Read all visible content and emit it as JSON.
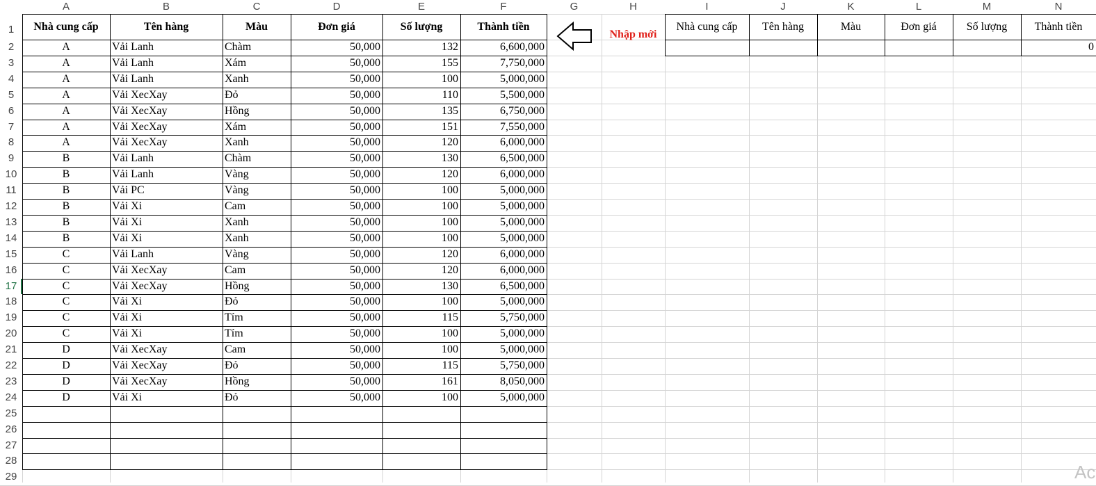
{
  "columns": [
    "A",
    "B",
    "C",
    "D",
    "E",
    "F",
    "G",
    "H",
    "I",
    "J",
    "K",
    "L",
    "M",
    "N"
  ],
  "rows": [
    "1",
    "2",
    "3",
    "4",
    "5",
    "6",
    "7",
    "8",
    "9",
    "10",
    "11",
    "12",
    "13",
    "14",
    "15",
    "16",
    "17",
    "18",
    "19",
    "20",
    "21",
    "22",
    "23",
    "24",
    "25",
    "26",
    "27",
    "28",
    "29"
  ],
  "active_row": "17",
  "table": {
    "headers": [
      "Nhà cung cấp",
      "Tên hàng",
      "Màu",
      "Đơn giá",
      "Số lượng",
      "Thành tiền"
    ],
    "rows": [
      [
        "A",
        "Vải Lanh",
        "Chàm",
        "50,000",
        "132",
        "6,600,000"
      ],
      [
        "A",
        "Vải Lanh",
        "Xám",
        "50,000",
        "155",
        "7,750,000"
      ],
      [
        "A",
        "Vải Lanh",
        "Xanh",
        "50,000",
        "100",
        "5,000,000"
      ],
      [
        "A",
        "Vải XecXay",
        "Đỏ",
        "50,000",
        "110",
        "5,500,000"
      ],
      [
        "A",
        "Vải XecXay",
        "Hồng",
        "50,000",
        "135",
        "6,750,000"
      ],
      [
        "A",
        "Vải XecXay",
        "Xám",
        "50,000",
        "151",
        "7,550,000"
      ],
      [
        "A",
        "Vải XecXay",
        "Xanh",
        "50,000",
        "120",
        "6,000,000"
      ],
      [
        "B",
        "Vải Lanh",
        "Chàm",
        "50,000",
        "130",
        "6,500,000"
      ],
      [
        "B",
        "Vải Lanh",
        "Vàng",
        "50,000",
        "120",
        "6,000,000"
      ],
      [
        "B",
        "Vải PC",
        "Vàng",
        "50,000",
        "100",
        "5,000,000"
      ],
      [
        "B",
        "Vải Xi",
        "Cam",
        "50,000",
        "100",
        "5,000,000"
      ],
      [
        "B",
        "Vải Xi",
        "Xanh",
        "50,000",
        "100",
        "5,000,000"
      ],
      [
        "B",
        "Vải Xi",
        "Xanh",
        "50,000",
        "100",
        "5,000,000"
      ],
      [
        "C",
        "Vải Lanh",
        "Vàng",
        "50,000",
        "120",
        "6,000,000"
      ],
      [
        "C",
        "Vải XecXay",
        "Cam",
        "50,000",
        "120",
        "6,000,000"
      ],
      [
        "C",
        "Vải XecXay",
        "Hồng",
        "50,000",
        "130",
        "6,500,000"
      ],
      [
        "C",
        "Vải Xi",
        "Đỏ",
        "50,000",
        "100",
        "5,000,000"
      ],
      [
        "C",
        "Vải Xi",
        "Tím",
        "50,000",
        "115",
        "5,750,000"
      ],
      [
        "C",
        "Vải Xi",
        "Tím",
        "50,000",
        "100",
        "5,000,000"
      ],
      [
        "D",
        "Vải XecXay",
        "Cam",
        "50,000",
        "100",
        "5,000,000"
      ],
      [
        "D",
        "Vải XecXay",
        "Đỏ",
        "50,000",
        "115",
        "5,750,000"
      ],
      [
        "D",
        "Vải XecXay",
        "Hồng",
        "50,000",
        "161",
        "8,050,000"
      ],
      [
        "D",
        "Vải Xi",
        "Đỏ",
        "50,000",
        "100",
        "5,000,000"
      ]
    ]
  },
  "entry": {
    "button_label": "Nhập mới",
    "headers": [
      "Nhà cung cấp",
      "Tên hàng",
      "Màu",
      "Đơn giá",
      "Số lượng",
      "Thành tiền"
    ],
    "values": [
      "",
      "",
      "",
      "",
      "",
      "0"
    ]
  },
  "watermark": "Ac",
  "icons": {
    "arrow": "left-arrow-icon"
  },
  "colors": {
    "grid": "#d4d4d4",
    "border": "#000000",
    "header_text": "#444444",
    "active_row": "#217346",
    "button_text": "#e0201a"
  }
}
